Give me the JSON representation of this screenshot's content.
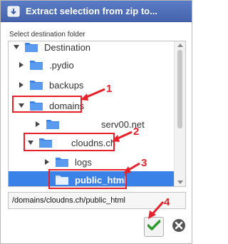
{
  "dialog": {
    "title": "Extract selection from zip to..."
  },
  "section_label": "Select destination folder",
  "tree": {
    "items": [
      {
        "label": "Destination"
      },
      {
        "label": ".pydio"
      },
      {
        "label": "backups"
      },
      {
        "label": "domains"
      },
      {
        "label": "serv00.net"
      },
      {
        "label": "cloudns.ch"
      },
      {
        "label": "logs"
      },
      {
        "label": "public_html"
      }
    ]
  },
  "path_field": {
    "value": "/domains/cloudns.ch/public_html"
  },
  "annotations": {
    "n1": "1",
    "n2": "2",
    "n3": "3",
    "n4": "4"
  },
  "colors": {
    "titlebar": "#4a69b3",
    "selection": "#3b82e8",
    "annotation": "#e8202a",
    "folder": "#3d84e6",
    "ok_check": "#2e9a2e"
  }
}
